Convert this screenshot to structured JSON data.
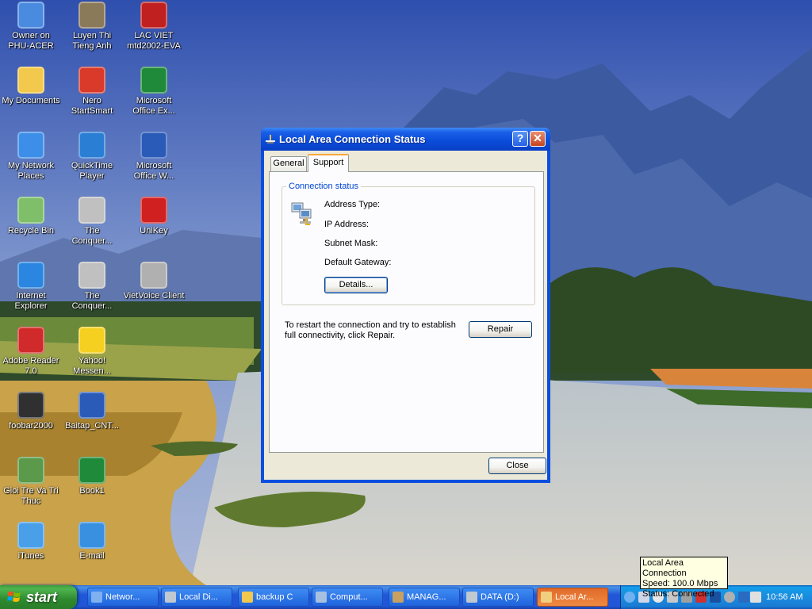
{
  "desktop": {
    "icons": [
      {
        "label": "Owner on\nPHU-ACER",
        "icon": "my-computer-icon",
        "color": "#4a8be0"
      },
      {
        "label": "Luyen Thi\nTieng Anh",
        "icon": "globe-icon",
        "color": "#8a7a5a"
      },
      {
        "label": "LAC VIET\nmtd2002-EVA",
        "icon": "lacviet-icon",
        "color": "#c02020"
      },
      {
        "label": "My Documents",
        "icon": "folder-icon",
        "color": "#f2c94c"
      },
      {
        "label": "Nero\nStartSmart",
        "icon": "nero-icon",
        "color": "#d93a2a"
      },
      {
        "label": "Microsoft\nOffice Ex...",
        "icon": "excel-icon",
        "color": "#1f8a3a"
      },
      {
        "label": "My Network\nPlaces",
        "icon": "network-places-icon",
        "color": "#3d8ee8"
      },
      {
        "label": "QuickTime\nPlayer",
        "icon": "quicktime-icon",
        "color": "#2a7fd4"
      },
      {
        "label": "Microsoft\nOffice W...",
        "icon": "word-icon",
        "color": "#2a5bb8"
      },
      {
        "label": "Recycle Bin",
        "icon": "recycle-bin-icon",
        "color": "#7fbf6a"
      },
      {
        "label": "The\nConquer...",
        "icon": "conqueror-icon",
        "color": "#c0c0c0"
      },
      {
        "label": "UniKey",
        "icon": "unikey-icon",
        "color": "#d02020"
      },
      {
        "label": "Internet\nExplorer",
        "icon": "internet-explorer-icon",
        "color": "#2a86e0"
      },
      {
        "label": "The\nConquer...",
        "icon": "conqueror-icon",
        "color": "#c0c0c0"
      },
      {
        "label": "VietVoice Client",
        "icon": "vietvoice-icon",
        "color": "#b0b0b0"
      },
      {
        "label": "Adobe Reader\n7.0",
        "icon": "adobe-reader-icon",
        "color": "#d02a2a"
      },
      {
        "label": "Yahoo!\nMessen...",
        "icon": "yahoo-messenger-icon",
        "color": "#f5d020"
      },
      {
        "label": "foobar2000",
        "icon": "foobar-icon",
        "color": "#303030"
      },
      {
        "label": "Baitap_CNT...",
        "icon": "word-doc-icon",
        "color": "#2a5bb8"
      },
      {
        "label": "Gioi Tre Va Tri\nThuc",
        "icon": "image-file-icon",
        "color": "#5a9a4a"
      },
      {
        "label": "Book1",
        "icon": "excel-doc-icon",
        "color": "#1f8a3a"
      },
      {
        "label": "iTunes",
        "icon": "itunes-icon",
        "color": "#4aa0e8"
      },
      {
        "label": "E-mail",
        "icon": "email-icon",
        "color": "#3a90e0"
      }
    ]
  },
  "window": {
    "title": "Local Area Connection Status",
    "help_glyph": "?",
    "close_glyph": "✕",
    "tabs": [
      "General",
      "Support"
    ],
    "active_tab": "Support",
    "group_title": "Connection status",
    "fields": [
      "Address Type:",
      "IP Address:",
      "Subnet Mask:",
      "Default Gateway:"
    ],
    "details_label": "Details...",
    "repair_text": "To restart the connection and try to establish full connectivity, click Repair.",
    "repair_label": "Repair",
    "close_label": "Close"
  },
  "taskbar": {
    "start_label": "start",
    "tasks": [
      {
        "label": "Networ...",
        "icon": "network-icon",
        "active": false
      },
      {
        "label": "Local Di...",
        "icon": "drive-icon",
        "active": false
      },
      {
        "label": "backup C",
        "icon": "folder-icon",
        "active": false
      },
      {
        "label": "Comput...",
        "icon": "computer-icon",
        "active": false
      },
      {
        "label": "MANAG...",
        "icon": "manager-icon",
        "active": false
      },
      {
        "label": "DATA (D:)",
        "icon": "drive-icon",
        "active": false
      },
      {
        "label": "Local Ar...",
        "icon": "network-connection-icon",
        "active": true
      }
    ],
    "clock": "10:56 AM"
  },
  "tooltip": {
    "line1": "Local Area Connection",
    "line2": "Speed: 100.0 Mbps",
    "line3": "Status: Connected"
  },
  "colors": {
    "titlebar": "#0a4bd8",
    "taskbar": "#2157d7",
    "start_button": "#3c9a3c",
    "active_tab_accent": "#f7a83a",
    "group_title": "#0046d5"
  }
}
